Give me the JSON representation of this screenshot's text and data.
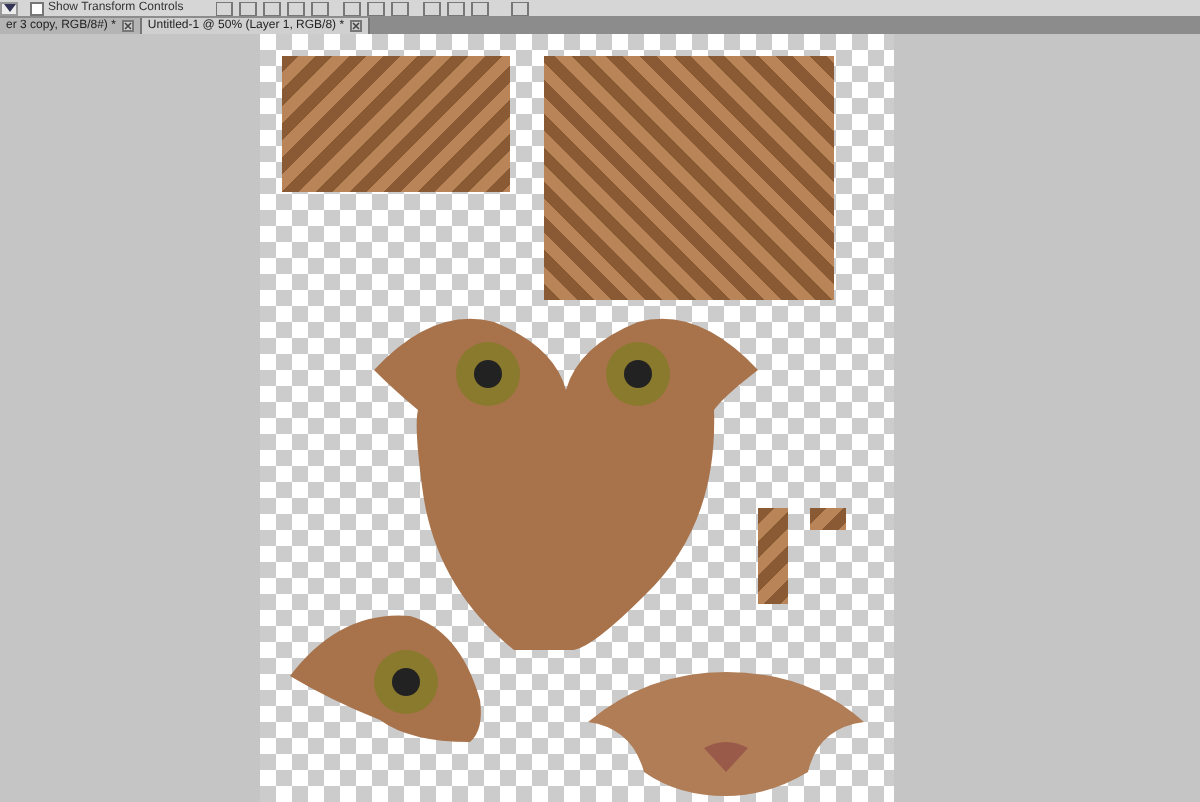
{
  "options_bar": {
    "checkbox": {
      "label": "Show Transform Controls",
      "checked": false
    }
  },
  "tabs": [
    {
      "label": "er 3 copy, RGB/8#) *",
      "selected": false
    },
    {
      "label": "Untitled-1 @ 50% (Layer 1, RGB/8) *",
      "selected": true
    }
  ]
}
